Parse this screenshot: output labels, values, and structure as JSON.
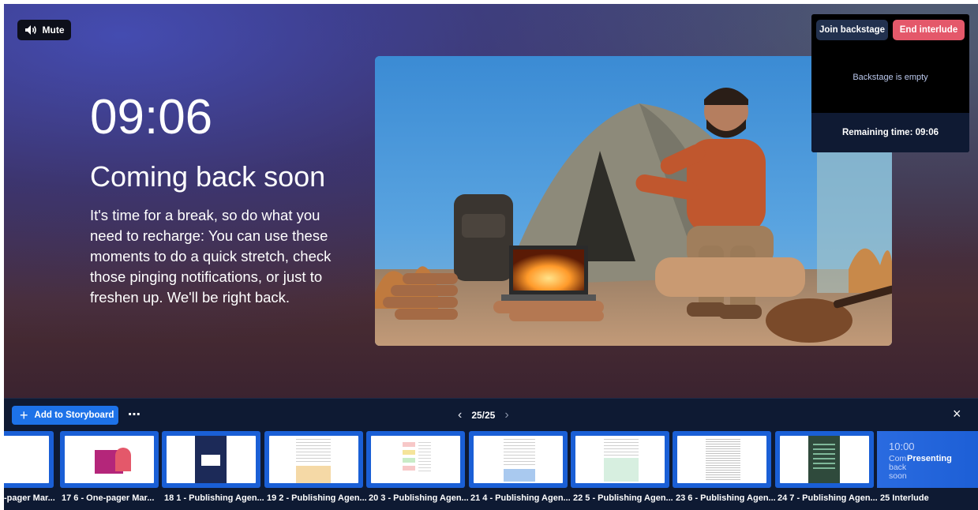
{
  "stage": {
    "mute_label": "Mute",
    "timer": "09:06",
    "headline": "Coming back soon",
    "body": "It's time for a break, so do what you need to recharge: You can use these moments to do a quick stretch, check those pinging notifications, or just to freshen up. We'll be right back."
  },
  "backstage": {
    "join_label": "Join backstage",
    "end_label": "End interlude",
    "empty_text": "Backstage is empty",
    "remaining_text": "Remaining time: 09:06"
  },
  "storyboard": {
    "add_label": "Add to Storyboard",
    "more_label": "⋯",
    "page_indicator": "25/25",
    "close_label": "×",
    "slides": [
      {
        "label": "-pager Mar..."
      },
      {
        "label": "17 6 - One-pager Mar..."
      },
      {
        "label": "18 1 - Publishing Agen..."
      },
      {
        "label": "19 2 - Publishing Agen..."
      },
      {
        "label": "20 3 - Publishing Agen..."
      },
      {
        "label": "21 4 - Publishing Agen..."
      },
      {
        "label": "22 5 - Publishing Agen..."
      },
      {
        "label": "23 6 - Publishing Agen..."
      },
      {
        "label": "24 7 - Publishing Agen..."
      },
      {
        "label": "25 Interlude"
      }
    ],
    "current_slide": {
      "time": "10:00",
      "line1": "Com",
      "line2": "back",
      "line3": "soon",
      "badge": "Presenting"
    }
  },
  "colors": {
    "accent": "#1d72e8",
    "end_button": "#e4586a",
    "join_button": "#22314f",
    "bar_bg": "#0e1a33"
  },
  "icons": [
    "speaker-icon",
    "plus-icon",
    "more-icon",
    "chevron-left-icon",
    "chevron-right-icon",
    "close-icon"
  ]
}
